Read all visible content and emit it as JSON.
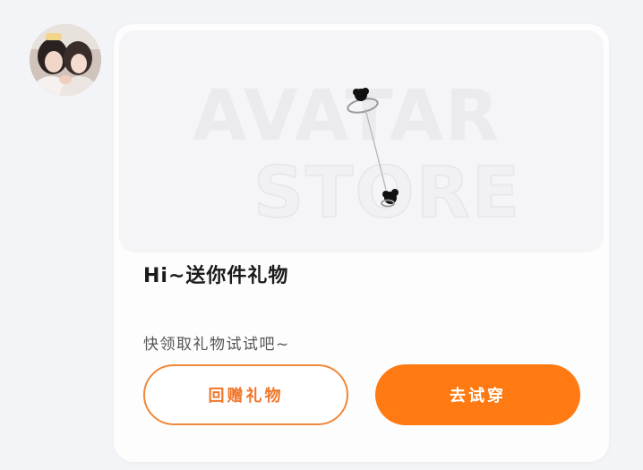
{
  "message": {
    "banner_text_line1": "AVATAR",
    "banner_text_line2": "STORE",
    "title": "Hi~送你件礼物",
    "subtitle": "快领取礼物试试吧~",
    "secondary_button_label": "回赠礼物",
    "primary_button_label": "去试穿"
  },
  "colors": {
    "accent": "#ff7a12",
    "outline": "#f0883a",
    "card_background": "#fdfdfe",
    "page_background": "#f3f4f7"
  },
  "icons": {
    "avatar": "user-avatar-photo",
    "product": "earring-chain-icon"
  }
}
